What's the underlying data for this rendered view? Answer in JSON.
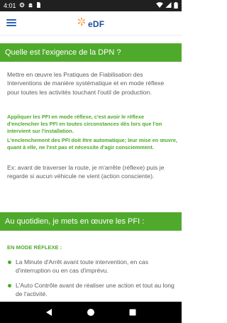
{
  "status_bar": {
    "time": "4:01",
    "left_icons": [
      "gear-icon",
      "android-icon",
      "sim-card-icon"
    ],
    "right_icons": [
      "wifi-icon",
      "signal-icon",
      "battery-icon"
    ]
  },
  "app_bar": {
    "menu_icon": "hamburger-menu-icon",
    "logo_text": "eDF",
    "colors": {
      "logo_blue": "#1c4d9e",
      "logo_orange": "#ff7a00",
      "menu_blue": "#2b63b5"
    }
  },
  "sections": {
    "section1": {
      "title": "Quelle est l'exigence de la DPN ?",
      "intro": "Mettre en œuvre les Pratiques de Fiabilisation des Interventions de manière systématique et en mode réflexe pour toutes les activités touchant l'outil de production.",
      "note1": "Appliquer les PFI en mode réflexe, c'est avoir le réflexe d'enclencher les PFI en toutes circonstances dès lors que l'on intervient sur l'installation.",
      "note2": "L'enclenchement des PFI doit être automatique; leur mise en œuvre, quant à elle, ne l'est pas et nécessite d'agir consciemment.",
      "example": "Ex: avant de traverser la route, je m'arrête (réflexe) puis je regarde si aucun véhicule ne vient (action consciente)."
    },
    "section2": {
      "title": "Au quotidien, je mets en œuvre les PFI :",
      "label": "EN MODE RÉFLEXE :",
      "bullets": [
        "La Minute d'Arrêt avant toute intervention, en cas d'interruption ou en cas d'imprévu.",
        "L'Auto Contrôle avant de réaliser une action et tout au long de l'activité."
      ]
    }
  },
  "colors": {
    "accent_green": "#4faa2c",
    "body_text": "#5d5d5d",
    "status_bar_bg": "#202020",
    "nav_bar_bg": "#000000"
  },
  "nav_bar": {
    "icons": [
      "back-icon",
      "home-icon",
      "recents-icon"
    ]
  }
}
